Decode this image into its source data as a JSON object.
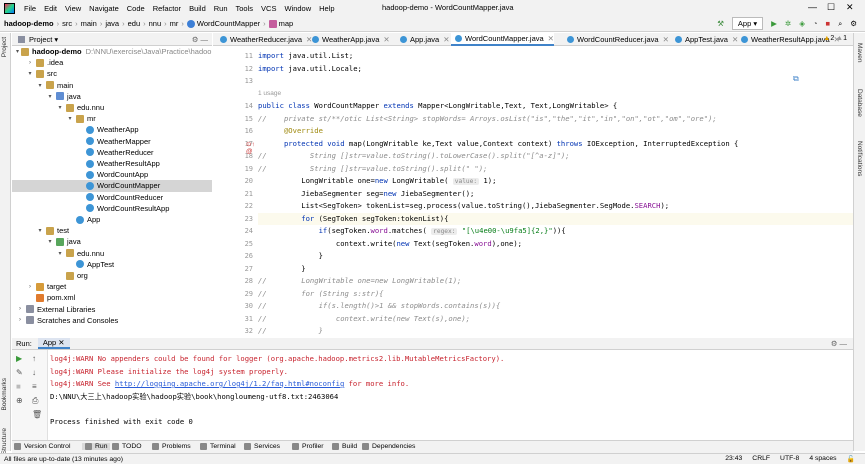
{
  "menu": {
    "items": [
      "File",
      "Edit",
      "View",
      "Navigate",
      "Code",
      "Refactor",
      "Build",
      "Run",
      "Tools",
      "VCS",
      "Window",
      "Help"
    ],
    "title": "hadoop-demo - WordCountMapper.java"
  },
  "nav": {
    "crumbs": [
      "hadoop-demo",
      "src",
      "main",
      "java",
      "edu",
      "nnu",
      "mr",
      "WordCountMapper",
      "map"
    ],
    "run_config": "App"
  },
  "left_stripe": [
    "Project",
    "Bookmarks",
    "Structure"
  ],
  "right_stripe": [
    "Maven",
    "Database",
    "Notifications"
  ],
  "project": {
    "header": "Project",
    "tree": [
      {
        "label": "hadoop-demo",
        "extra": "D:\\NNU\\exercise\\Java\\Practice\\hadoop",
        "indent": 0,
        "arrow": "v",
        "icon": "ic-folder"
      },
      {
        "label": ".idea",
        "indent": 1,
        "arrow": ">",
        "icon": "ic-folder"
      },
      {
        "label": "src",
        "indent": 1,
        "arrow": "v",
        "icon": "ic-folder"
      },
      {
        "label": "main",
        "indent": 2,
        "arrow": "v",
        "icon": "ic-folder"
      },
      {
        "label": "java",
        "indent": 3,
        "arrow": "v",
        "icon": "ic-src"
      },
      {
        "label": "edu.nnu",
        "indent": 4,
        "arrow": "v",
        "icon": "ic-folder"
      },
      {
        "label": "mr",
        "indent": 5,
        "arrow": "v",
        "icon": "ic-folder"
      },
      {
        "label": "WeatherApp",
        "indent": 6,
        "arrow": "",
        "icon": "ic-class"
      },
      {
        "label": "WeatherMapper",
        "indent": 6,
        "arrow": "",
        "icon": "ic-class"
      },
      {
        "label": "WeatherReducer",
        "indent": 6,
        "arrow": "",
        "icon": "ic-class"
      },
      {
        "label": "WeatherResultApp",
        "indent": 6,
        "arrow": "",
        "icon": "ic-class"
      },
      {
        "label": "WordCountApp",
        "indent": 6,
        "arrow": "",
        "icon": "ic-class"
      },
      {
        "label": "WordCountMapper",
        "indent": 6,
        "arrow": "",
        "icon": "ic-class",
        "selected": true
      },
      {
        "label": "WordCountReducer",
        "indent": 6,
        "arrow": "",
        "icon": "ic-class"
      },
      {
        "label": "WordCountResultApp",
        "indent": 6,
        "arrow": "",
        "icon": "ic-class"
      },
      {
        "label": "App",
        "indent": 5,
        "arrow": "",
        "icon": "ic-class"
      },
      {
        "label": "test",
        "indent": 2,
        "arrow": "v",
        "icon": "ic-folder"
      },
      {
        "label": "java",
        "indent": 3,
        "arrow": "v",
        "icon": "ic-test"
      },
      {
        "label": "edu.nnu",
        "indent": 4,
        "arrow": "v",
        "icon": "ic-folder"
      },
      {
        "label": "AppTest",
        "indent": 5,
        "arrow": "",
        "icon": "ic-class"
      },
      {
        "label": "org",
        "indent": 4,
        "arrow": "",
        "icon": "ic-folder"
      },
      {
        "label": "target",
        "indent": 1,
        "arrow": ">",
        "icon": "ic-out"
      },
      {
        "label": "pom.xml",
        "indent": 1,
        "arrow": "",
        "icon": "ic-file"
      },
      {
        "label": "External Libraries",
        "indent": 0,
        "arrow": ">",
        "icon": "ic-lib"
      },
      {
        "label": "Scratches and Consoles",
        "indent": 0,
        "arrow": ">",
        "icon": "ic-lib"
      }
    ]
  },
  "tabs": [
    "WeatherReducer.java",
    "WeatherApp.java",
    "App.java",
    "WordCountMapper.java",
    "WordCountReducer.java",
    "AppTest.java",
    "WeatherResultApp.java"
  ],
  "active_tab": 3,
  "inspections": {
    "warnings": "2",
    "weak": "1"
  },
  "editor": {
    "line_numbers": [
      "11",
      "12",
      "13",
      "14",
      "15",
      "16",
      "17",
      "18",
      "19",
      "20",
      "21",
      "22",
      "23",
      "24",
      "25",
      "26",
      "27",
      "28",
      "29",
      "30",
      "31",
      "32"
    ],
    "usage": "1 usage",
    "lines": [
      {
        "kind": "code",
        "t": [
          {
            "s": "import ",
            "c": "kw"
          },
          {
            "s": "java.util.List;"
          }
        ]
      },
      {
        "kind": "code",
        "t": [
          {
            "s": "import ",
            "c": "kw"
          },
          {
            "s": "java.util.Locale;"
          }
        ]
      },
      {
        "kind": "blank",
        "t": []
      },
      {
        "kind": "code",
        "t": [
          {
            "s": "public class ",
            "c": "kw"
          },
          {
            "s": "WordCountMapper "
          },
          {
            "s": "extends ",
            "c": "kw"
          },
          {
            "s": "Mapper<LongWritable,Text, Text,LongWritable> {"
          }
        ]
      },
      {
        "kind": "code",
        "t": [
          {
            "s": "//    private st/**/otic List<String> stopWords= Arroys.osList(\"is\",\"the\",\"it\",\"in\",\"on\",\"ot\",\"om\",\"ore\");",
            "c": "cm"
          }
        ]
      },
      {
        "kind": "code",
        "t": [
          {
            "s": "      "
          },
          {
            "s": "@Override",
            "c": "an"
          }
        ]
      },
      {
        "kind": "code",
        "t": [
          {
            "s": "      "
          },
          {
            "s": "protected void ",
            "c": "kw"
          },
          {
            "s": "map(LongWritable ke,Text value,Context context) "
          },
          {
            "s": "throws ",
            "c": "kw"
          },
          {
            "s": "IOException, InterruptedException {"
          }
        ]
      },
      {
        "kind": "code",
        "t": [
          {
            "s": "//          String []str=value.toString().toLowerCase().split(\"[^a-z]\");",
            "c": "cm"
          }
        ]
      },
      {
        "kind": "code",
        "t": [
          {
            "s": "//          String []str=value.toString().split(\" \");",
            "c": "cm"
          }
        ]
      },
      {
        "kind": "code",
        "t": [
          {
            "s": "          LongWritable one="
          },
          {
            "s": "new ",
            "c": "kw"
          },
          {
            "s": "LongWritable( "
          },
          {
            "s": "value:",
            "c": "hint"
          },
          {
            "s": " 1);"
          }
        ]
      },
      {
        "kind": "code",
        "t": [
          {
            "s": "          JiebaSegmenter seg="
          },
          {
            "s": "new ",
            "c": "kw"
          },
          {
            "s": "JiebaSegmenter();"
          }
        ]
      },
      {
        "kind": "code",
        "t": [
          {
            "s": "          List<SegToken> tokenList=seg.process(value.toString(),JiebaSegmenter.SegMode."
          },
          {
            "s": "SEARCH",
            "c": "fld"
          },
          {
            "s": ");"
          }
        ]
      },
      {
        "kind": "code",
        "hl": true,
        "t": [
          {
            "s": "          "
          },
          {
            "s": "for ",
            "c": "kw"
          },
          {
            "s": "(SegToken segToken:tokenList){"
          }
        ]
      },
      {
        "kind": "code",
        "t": [
          {
            "s": "              "
          },
          {
            "s": "if",
            "c": "kw"
          },
          {
            "s": "(segToken."
          },
          {
            "s": "word",
            "c": "fld"
          },
          {
            "s": ".matches( "
          },
          {
            "s": "regex:",
            "c": "hint"
          },
          {
            "s": " "
          },
          {
            "s": "\"[\\u4e00-\\u9fa5]{2,}\"",
            "c": "str"
          },
          {
            "s": ")){"
          }
        ]
      },
      {
        "kind": "code",
        "t": [
          {
            "s": "                  context.write("
          },
          {
            "s": "new ",
            "c": "kw"
          },
          {
            "s": "Text(segToken."
          },
          {
            "s": "word",
            "c": "fld"
          },
          {
            "s": "),one);"
          }
        ]
      },
      {
        "kind": "code",
        "t": [
          {
            "s": "              }"
          }
        ]
      },
      {
        "kind": "code",
        "t": [
          {
            "s": "          }"
          }
        ]
      },
      {
        "kind": "code",
        "t": [
          {
            "s": "//        LongWritable one=new LongWritable(1);",
            "c": "cm"
          }
        ]
      },
      {
        "kind": "code",
        "t": [
          {
            "s": "//        for (String s:str){",
            "c": "cm"
          }
        ]
      },
      {
        "kind": "code",
        "t": [
          {
            "s": "//            if(s.length()>1 && stopWords.contains(s)){",
            "c": "cm"
          }
        ]
      },
      {
        "kind": "code",
        "t": [
          {
            "s": "//                context.write(new Text(s),one);",
            "c": "cm"
          }
        ]
      },
      {
        "kind": "code",
        "t": [
          {
            "s": "//            }",
            "c": "cm"
          }
        ]
      }
    ]
  },
  "run": {
    "label": "Run:",
    "config": "App",
    "output": [
      {
        "c": "red",
        "s": "log4j:WARN No appenders could be found for logger (org.apache.hadoop.metrics2.lib.MutableMetricsFactory)."
      },
      {
        "c": "red",
        "s": "log4j:WARN Please initialize the log4j system properly."
      },
      {
        "c": "red",
        "s": "log4j:WARN See ",
        "link": "http://logging.apache.org/log4j/1.2/faq.html#noconfig",
        "after": " for more info."
      },
      {
        "c": "",
        "s": "D:\\NNU\\大三上\\hadoop实验\\hadoop实验\\book\\hongloumeng-utf8.txt:2463064"
      },
      {
        "c": "",
        "s": ""
      },
      {
        "c": "",
        "s": "Process finished with exit code 0"
      }
    ]
  },
  "bottom_tabs": [
    "Version Control",
    "Run",
    "TODO",
    "Problems",
    "Terminal",
    "Services",
    "Profiler",
    "Build",
    "Dependencies"
  ],
  "status": {
    "left": "All files are up-to-date (13 minutes ago)",
    "right": [
      "23:43",
      "CRLF",
      "UTF-8",
      "4 spaces"
    ]
  }
}
